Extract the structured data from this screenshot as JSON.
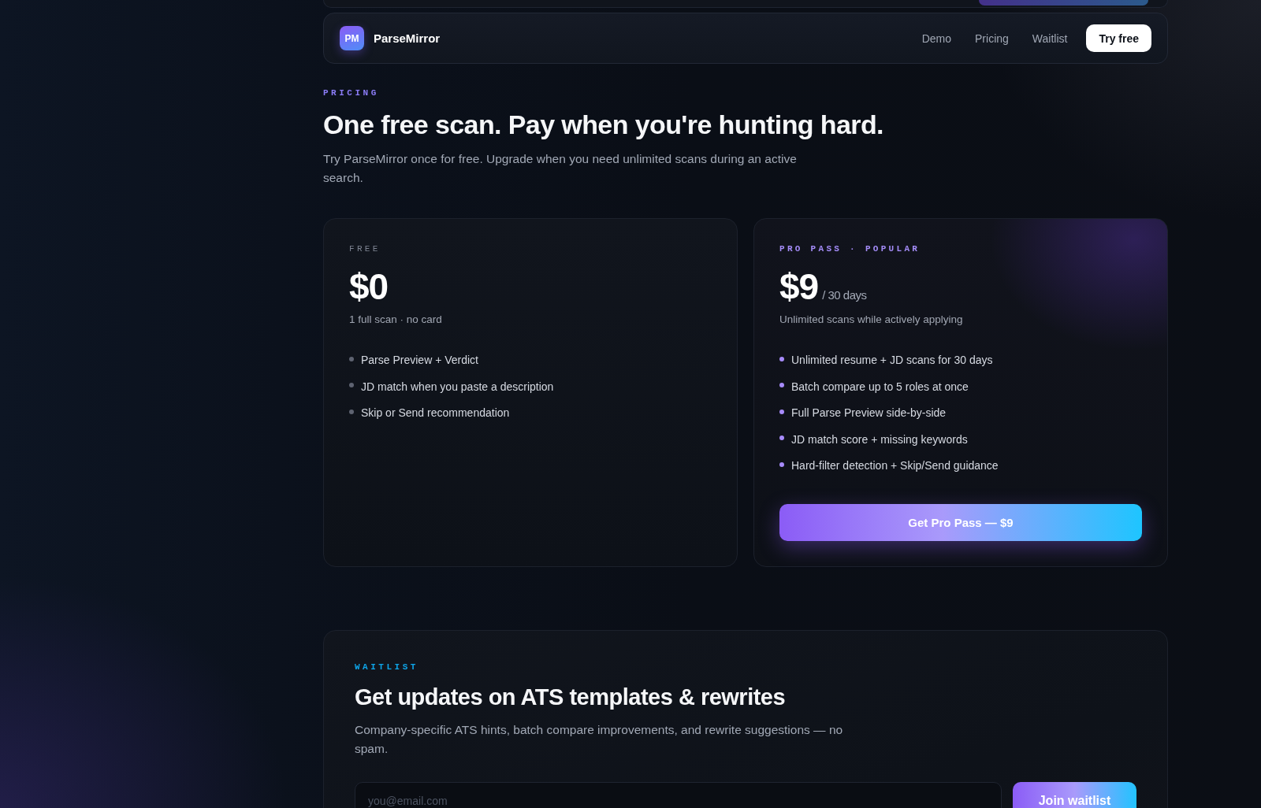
{
  "nav": {
    "logo_mark": "PM",
    "brand": "ParseMirror",
    "links": [
      {
        "label": "Demo"
      },
      {
        "label": "Pricing"
      },
      {
        "label": "Waitlist"
      }
    ],
    "cta": "Try free"
  },
  "pricing": {
    "eyebrow": "PRICING",
    "title": "One free scan. Pay when you're hunting hard.",
    "subtitle": "Try ParseMirror once for free. Upgrade when you need unlimited scans during an active search.",
    "plans": [
      {
        "label": "FREE",
        "featured": false,
        "price": "$0",
        "note": "1 full scan · no card",
        "features": [
          "Parse Preview + Verdict",
          "JD match when you paste a description",
          "Skip or Send recommendation"
        ]
      },
      {
        "label": "PRO PASS · POPULAR",
        "featured": true,
        "price": "$9",
        "period": "/ 30 days",
        "note": "Unlimited scans while actively applying",
        "features": [
          "Unlimited resume + JD scans for 30 days",
          "Batch compare up to 5 roles at once",
          "Full Parse Preview side-by-side",
          "JD match score + missing keywords",
          "Hard-filter detection + Skip/Send guidance"
        ],
        "button": "Get Pro Pass — $9"
      }
    ]
  },
  "waitlist": {
    "eyebrow": "WAITLIST",
    "title": "Get updates on ATS templates & rewrites",
    "text": "Company-specific ATS hints, batch compare improvements, and rewrite suggestions — no spam.",
    "email": {
      "placeholder": "you@email.com"
    },
    "button": "Join waitlist"
  }
}
